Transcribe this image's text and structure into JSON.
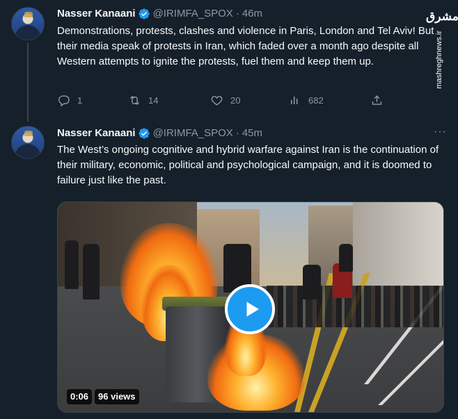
{
  "tweets": [
    {
      "author_name": "Nasser Kanaani",
      "handle": "@IRIMFA_SPOX",
      "separator": "·",
      "time": "46m",
      "text": "Demonstrations, protests, clashes and violence in Paris, London and Tel Aviv! But their media speak of protests in Iran, which faded over a month ago despite all Western attempts to ignite the protests, fuel them and keep them up.",
      "replies": "1",
      "retweets": "14",
      "likes": "20",
      "views": "682"
    },
    {
      "author_name": "Nasser Kanaani",
      "handle": "@IRIMFA_SPOX",
      "separator": "·",
      "time": "45m",
      "more": "···",
      "text": "The West’s ongoing cognitive and hybrid warfare against Iran is the continuation of their military, economic, political and psychological campaign, and it is doomed to failure just like the past.",
      "video": {
        "duration": "0:06",
        "views": "96 views"
      }
    }
  ],
  "watermark": {
    "logo": "مشرق",
    "site": "mashreghnews.ir"
  },
  "colors": {
    "background": "#15202b",
    "text": "#f7f9f9",
    "secondary": "#8b98a5",
    "accent": "#1d9bf0"
  },
  "icons": {
    "reply": "reply-icon",
    "retweet": "retweet-icon",
    "like": "heart-icon",
    "views": "analytics-icon",
    "share": "share-icon",
    "verified": "verified-badge-icon",
    "play": "play-icon"
  }
}
